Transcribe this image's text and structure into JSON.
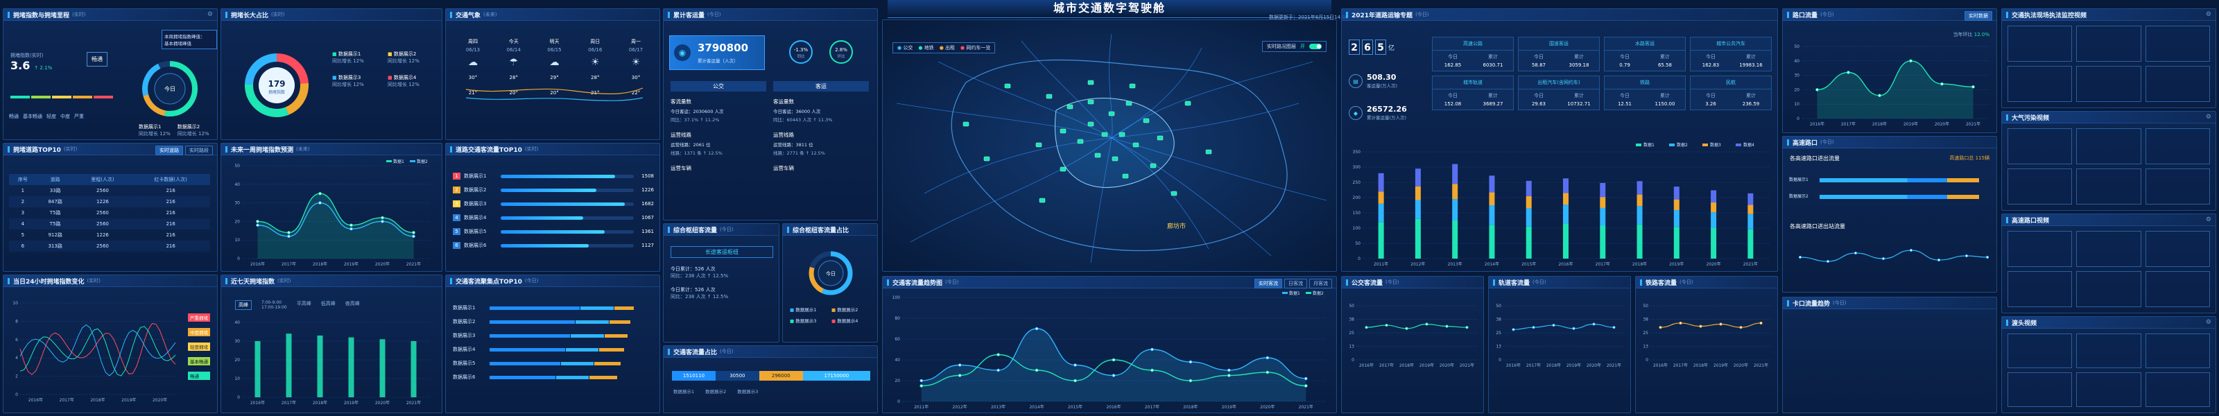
{
  "title": "城市交通数字驾驶舱",
  "topbar": {
    "left_tag": "",
    "right_tag": "数据更新于：2021年6月15日14:00"
  },
  "p_congestion": {
    "title": "拥堵指数与拥堵里程",
    "unit": "(实时)",
    "index_label": "拥堵指数(实时)",
    "index_value": "3.6",
    "change": "↑ 2.1%",
    "level": "畅通",
    "legend": [
      "畅通",
      "基本畅通",
      "轻度",
      "中度",
      "严重"
    ],
    "ring_center": "今日",
    "items": [
      {
        "name": "数据展示1",
        "val": "同比增长 12%"
      },
      {
        "name": "数据展示2",
        "val": "同比增长 12%"
      }
    ],
    "popup": [
      "本周拥堵指数峰值：",
      "基本拥堵峰值"
    ]
  },
  "p_ratio": {
    "title": "拥堵长大占比",
    "unit": "(实时)",
    "center_value": "179",
    "center_label": "拥堵指数",
    "items": [
      {
        "name": "数据展示1",
        "val": "同比增长 12%"
      },
      {
        "name": "数据展示2",
        "val": "同比增长 12%"
      },
      {
        "name": "数据展示3",
        "val": "同比增长 12%"
      },
      {
        "name": "数据展示4",
        "val": "同比增长 12%"
      }
    ]
  },
  "p_weather": {
    "title": "交通气象",
    "unit": "(未来)",
    "days": [
      {
        "name": "周四",
        "date": "06/13",
        "icon": "cloud-icon",
        "hi": "30°",
        "lo": "21°"
      },
      {
        "name": "今天",
        "date": "06/14",
        "icon": "rain-icon",
        "hi": "28°",
        "lo": "20°"
      },
      {
        "name": "明天",
        "date": "06/15",
        "icon": "cloud-icon",
        "hi": "29°",
        "lo": "20°"
      },
      {
        "name": "周日",
        "date": "06/16",
        "icon": "sun-icon",
        "hi": "28°",
        "lo": "21°"
      },
      {
        "name": "周一",
        "date": "06/17",
        "icon": "sun-icon",
        "hi": "30°",
        "lo": "22°"
      }
    ]
  },
  "p_passenger": {
    "title": "累计客运量",
    "unit": "(今日)",
    "total": "3790800",
    "total_label": "累计客运量（人次）",
    "ring1": {
      "value": "-1.3%",
      "label": "同比"
    },
    "ring2": {
      "value": "2.8%",
      "label": "环比"
    },
    "col1_head": "公交",
    "col2_head": "客运",
    "groups": [
      {
        "a": {
          "title": "客流量数",
          "l1": "今日客运：2030600 人次",
          "l2": "同比：37.1% ↑ 11.2%"
        },
        "b": {
          "title": "客运量数",
          "l1": "今日客运：36000 人次",
          "l2": "同比：60443 人次 ↑ 11.3%"
        }
      },
      {
        "a": {
          "title": "运营线路",
          "l1": "运营线路：2061 位",
          "l2": "线路：1371 条 ↑ 12.5%"
        },
        "b": {
          "title": "运营线路",
          "l1": "运营线路：3811 位",
          "l2": "线路：2771 条 ↑ 12.5%"
        }
      },
      {
        "a": {
          "title": "运营车辆",
          "l1": "",
          "l2": ""
        },
        "b": {
          "title": "运营车辆",
          "l1": "",
          "l2": ""
        }
      }
    ]
  },
  "p_hub": {
    "title": "综合枢纽客流量",
    "unit": "(今日)",
    "sub_title": "长途客运枢纽",
    "rows": [
      {
        "l1": "今日累计：526 人次",
        "l2": "同比：238 人次 ↑ 12.5%"
      },
      {
        "l1": "今日累计：526 人次",
        "l2": "同比：238 人次 ↑ 12.5%"
      }
    ]
  },
  "p_hub_ratio": {
    "title": "综合枢纽客流量占比",
    "unit": "(今日)",
    "center": "今日",
    "items": [
      "数据展示1",
      "数据展示2",
      "数据展示3",
      "数据展示4"
    ]
  },
  "p_share": {
    "title": "交通客流量占比",
    "unit": "(今日)",
    "segments": [
      {
        "v": "1510110",
        "c": "#1e8fff"
      },
      {
        "v": "30500",
        "c": "#0f3f80"
      },
      {
        "v": "296000",
        "c": "#f0a830"
      },
      {
        "v": "17150000",
        "c": "#2fb6ff"
      }
    ],
    "items": [
      "数据展示1",
      "数据展示2",
      "数据展示3"
    ]
  },
  "p_top10": {
    "title": "拥堵道路TOP10",
    "unit": "(实时)",
    "btn1": "实时道路",
    "btn2": "实时路段",
    "headers": [
      "序号",
      "道路",
      "里程(人次)",
      "红卡数据(人次)"
    ],
    "rows": [
      [
        "1",
        "33路",
        "2560",
        "216"
      ],
      [
        "2",
        "847路",
        "1226",
        "216"
      ],
      [
        "3",
        "T5路",
        "2560",
        "216"
      ],
      [
        "4",
        "T5路",
        "2560",
        "216"
      ],
      [
        "5",
        "912路",
        "1226",
        "216"
      ],
      [
        "6",
        "313路",
        "2560",
        "216"
      ]
    ]
  },
  "p_forecast": {
    "title": "未来一周拥堵指数预测",
    "unit": "(未来)"
  },
  "p_road_top10": {
    "title": "道路交通客流量TOP10",
    "unit": "(实时)",
    "rows": [
      {
        "name": "数据展示1",
        "v": "1508",
        "p": 0.86
      },
      {
        "name": "数据展示2",
        "v": "1226",
        "p": 0.72
      },
      {
        "name": "数据展示3",
        "v": "1682",
        "p": 0.93
      },
      {
        "name": "数据展示4",
        "v": "1067",
        "p": 0.62
      },
      {
        "name": "数据展示5",
        "v": "1361",
        "p": 0.78
      },
      {
        "name": "数据展示6",
        "v": "1127",
        "p": 0.66
      }
    ]
  },
  "p_hourly": {
    "title": "当日24小时拥堵指数变化",
    "unit": "(实时)",
    "tags": [
      "严重拥堵",
      "中度拥堵",
      "轻度拥堵",
      "基本畅通",
      "畅通"
    ]
  },
  "p_week": {
    "title": "近七天拥堵指数",
    "unit": "(实时)",
    "tabs": [
      "高峰",
      "平高峰",
      "低高峰",
      "夜高峰"
    ],
    "tab_time": [
      "7:00-9:00",
      "17:00-19:00"
    ],
    "unit_label": "单位"
  },
  "p_hotspot": {
    "title": "交通客流聚集点TOP10",
    "unit": "(今日)",
    "rows": [
      "数据展示1",
      "数据展示2",
      "数据展示3",
      "数据展示4",
      "数据展示5",
      "数据展示6"
    ]
  },
  "map": {
    "city": "廊坊市",
    "legend": [
      "公交",
      "地铁",
      "出租",
      "网约车一览"
    ],
    "toggle_label": "实时路况图层",
    "toggle_val": "开"
  },
  "p_plan": {
    "title": "2021年道路运输专题",
    "unit": "(今日)",
    "big_digits": [
      "2",
      "6",
      "5"
    ],
    "big_unit": "亿",
    "kpi1": {
      "value": "508.30",
      "label": "客运量(万人次)"
    },
    "kpi2": {
      "value": "26572.26",
      "label": "累计客运量(万人次)"
    },
    "cards": [
      {
        "title": "高速公路",
        "a": "今日",
        "b": "累计",
        "va": "162.85",
        "vb": "6030.71"
      },
      {
        "title": "国道客运",
        "a": "今日",
        "b": "累计",
        "va": "58.87",
        "vb": "3059.18"
      },
      {
        "title": "水路客运",
        "a": "今日",
        "b": "累计",
        "va": "0.79",
        "vb": "65.58"
      },
      {
        "title": "城市公共汽车",
        "a": "今日",
        "b": "累计",
        "va": "162.83",
        "vb": "19983.16"
      },
      {
        "title": "城市轨道",
        "a": "今日",
        "b": "累计",
        "va": "152.08",
        "vb": "3689.27"
      },
      {
        "title": "出租汽车(含网约车)",
        "a": "今日",
        "b": "累计",
        "va": "29.63",
        "vb": "10732.71"
      },
      {
        "title": "铁路",
        "a": "今日",
        "b": "累计",
        "va": "12.51",
        "vb": "1150.00"
      },
      {
        "title": "民航",
        "a": "今日",
        "b": "累计",
        "va": "3.26",
        "vb": "236.59"
      }
    ]
  },
  "p_bus": {
    "title": "公交客流量",
    "unit": "(今日)"
  },
  "p_metro": {
    "title": "轨道客流量",
    "unit": "(今日)"
  },
  "p_railway": {
    "title": "铁路客流量",
    "unit": "(今日)"
  },
  "p_car_flow": {
    "title": "交通客流量趋势图",
    "unit": "(今日)",
    "btns": [
      "实时客流",
      "日客流",
      "月客流"
    ]
  },
  "p_port": {
    "title": "路口流量",
    "unit": "(今日)",
    "btn": "实时数据",
    "label": "当年环比",
    "value": "12.0%"
  },
  "p_cross": {
    "title": "高速路口",
    "unit": "(今日)",
    "sub1": "各高速路口进出流量",
    "sub2": "各高速路口进出站流量",
    "hint": "高速路口总 115辆",
    "legend": [
      "数据1",
      "数据2",
      "数据3"
    ]
  },
  "p_gates": {
    "title": "卡口流量趋势",
    "unit": "(今日)"
  },
  "p_video1": {
    "title": "交通执法现场执法监控视频",
    "unit": ""
  },
  "p_video2": {
    "title": "大气污染视频",
    "unit": ""
  },
  "p_video3": {
    "title": "高速路口视频",
    "unit": ""
  },
  "p_video4": {
    "title": "渡头视频",
    "unit": ""
  },
  "years": [
    "2016年",
    "2017年",
    "2018年",
    "2019年",
    "2020年",
    "2021年"
  ],
  "years_long": [
    "2011年",
    "2012年",
    "2013年",
    "2014年",
    "2015年",
    "2016年",
    "2017年",
    "2018年",
    "2019年",
    "2020年",
    "2021年"
  ],
  "chart_data": [
    {
      "type": "line",
      "title": "未来一周拥堵指数预测",
      "x": [
        "2016年",
        "2017年",
        "2018年",
        "2019年",
        "2020年",
        "2021年"
      ],
      "series": [
        {
          "name": "数据1",
          "values": [
            20,
            14,
            35,
            18,
            22,
            14
          ]
        },
        {
          "name": "数据2",
          "values": [
            18,
            12,
            30,
            16,
            20,
            12
          ]
        }
      ],
      "ylim": [
        0,
        50
      ]
    },
    {
      "type": "bar",
      "title": "近七天拥堵指数",
      "categories": [
        "2016年",
        "2017年",
        "2018年",
        "2019年",
        "2020年",
        "2021年"
      ],
      "values": [
        30,
        34,
        33,
        32,
        31,
        30
      ],
      "ylim": [
        0,
        40
      ]
    },
    {
      "type": "bar",
      "title": "2021年道路运输专题",
      "categories": [
        "2011年",
        "2012年",
        "2013年",
        "2014年",
        "2015年",
        "2016年",
        "2017年",
        "2018年",
        "2019年",
        "2020年",
        "2021年"
      ],
      "series": [
        {
          "name": "数据1",
          "values": [
            120,
            130,
            125,
            110,
            105,
            115,
            108,
            112,
            104,
            100,
            96
          ]
        },
        {
          "name": "数据2",
          "values": [
            60,
            62,
            70,
            65,
            60,
            62,
            58,
            60,
            55,
            52,
            50
          ]
        },
        {
          "name": "数据3",
          "values": [
            40,
            45,
            50,
            42,
            40,
            38,
            36,
            38,
            35,
            32,
            30
          ]
        },
        {
          "name": "数据4",
          "values": [
            60,
            58,
            65,
            55,
            50,
            48,
            46,
            44,
            42,
            40,
            38
          ]
        }
      ],
      "ylim": [
        0,
        350
      ]
    },
    {
      "type": "line",
      "title": "交通客流量趋势图",
      "x": [
        "2011年",
        "2012年",
        "2013年",
        "2014年",
        "2015年",
        "2016年",
        "2017年",
        "2018年",
        "2019年",
        "2020年",
        "2021年"
      ],
      "series": [
        {
          "name": "数据1",
          "values": [
            20,
            35,
            30,
            70,
            35,
            25,
            50,
            38,
            30,
            42,
            22
          ]
        },
        {
          "name": "数据2",
          "values": [
            15,
            25,
            45,
            30,
            20,
            40,
            30,
            20,
            25,
            28,
            15
          ]
        }
      ],
      "ylim": [
        0,
        100
      ]
    },
    {
      "type": "line",
      "title": "路口流量",
      "x": [
        "2016年",
        "2017年",
        "2018年",
        "2019年",
        "2020年",
        "2021年"
      ],
      "series": [
        {
          "name": "数据1",
          "values": [
            20,
            32,
            16,
            40,
            24,
            22
          ]
        }
      ],
      "ylim": [
        0,
        50
      ]
    }
  ],
  "colors": {
    "accent": "#2fb6ff",
    "green": "#1ee6b4",
    "orange": "#f0a830",
    "red": "#ff4d5e",
    "yellow": "#ffd24a"
  }
}
